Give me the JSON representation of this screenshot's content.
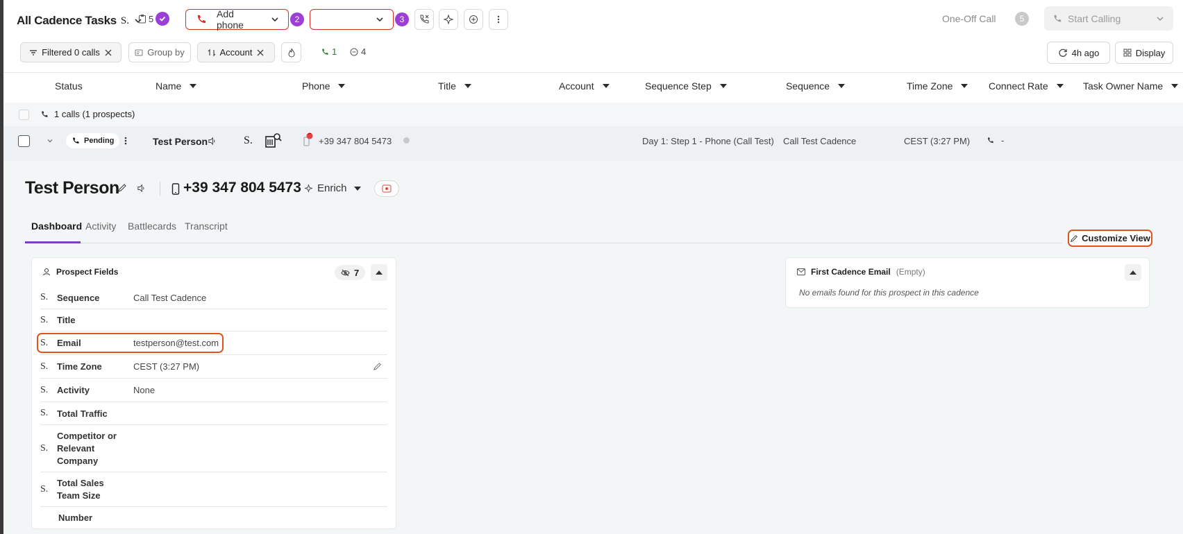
{
  "toolbar": {
    "view_title": "All Cadence Tasks",
    "task_count": "5",
    "add_phone_label": "Add phone",
    "step2_badge": "2",
    "step3_badge": "3",
    "one_off_call": "One-Off Call",
    "one_off_badge": "5",
    "start_calling": "Start Calling"
  },
  "filters": {
    "filtered_calls": "Filtered 0 calls",
    "group_by": "Group by",
    "sort_account": "Account",
    "connected_count": "1",
    "skipped_count": "4",
    "refresh_ago": "4h ago",
    "display": "Display"
  },
  "table": {
    "columns": [
      "Status",
      "Name",
      "Phone",
      "Title",
      "Account",
      "Sequence Step",
      "Sequence",
      "Time Zone",
      "Connect Rate",
      "Task Owner Name"
    ],
    "group_label": "1 calls (1 prospects)",
    "row": {
      "status": "Pending",
      "name": "Test Person",
      "phone": "+39 347 804 5473",
      "sequence_step": "Day 1: Step 1 - Phone (Call Test)",
      "sequence": "Call Test Cadence",
      "time_zone": "CEST (3:27 PM)",
      "connect_rate": "-"
    }
  },
  "prospect": {
    "name": "Test Person",
    "phone": "+39 347 804 5473",
    "enrich": "Enrich",
    "tabs": [
      "Dashboard",
      "Activity",
      "Battlecards",
      "Transcript"
    ],
    "active_tab": "Dashboard",
    "customize_view": "Customize View"
  },
  "prospect_fields": {
    "title": "Prospect Fields",
    "hidden_count": "7",
    "fields": [
      {
        "label": "Sequence",
        "value": "Call Test Cadence"
      },
      {
        "label": "Title",
        "value": ""
      },
      {
        "label": "Email",
        "value": "testperson@test.com"
      },
      {
        "label": "Time Zone",
        "value": "CEST (3:27 PM)"
      },
      {
        "label": "Activity",
        "value": "None"
      },
      {
        "label": "Total Traffic",
        "value": ""
      },
      {
        "label": "Competitor or Relevant Company",
        "value": ""
      },
      {
        "label": "Total Sales Team Size",
        "value": ""
      },
      {
        "label": "Number",
        "value": ""
      }
    ]
  },
  "email_panel": {
    "title": "First Cadence Email",
    "status": "(Empty)",
    "empty_message": "No emails found for this prospect in this cadence"
  },
  "colors": {
    "accent_purple": "#9b3fd6",
    "danger_red": "#d93025",
    "highlight_orange": "#e0531f",
    "row_bg": "#eef1f3"
  }
}
